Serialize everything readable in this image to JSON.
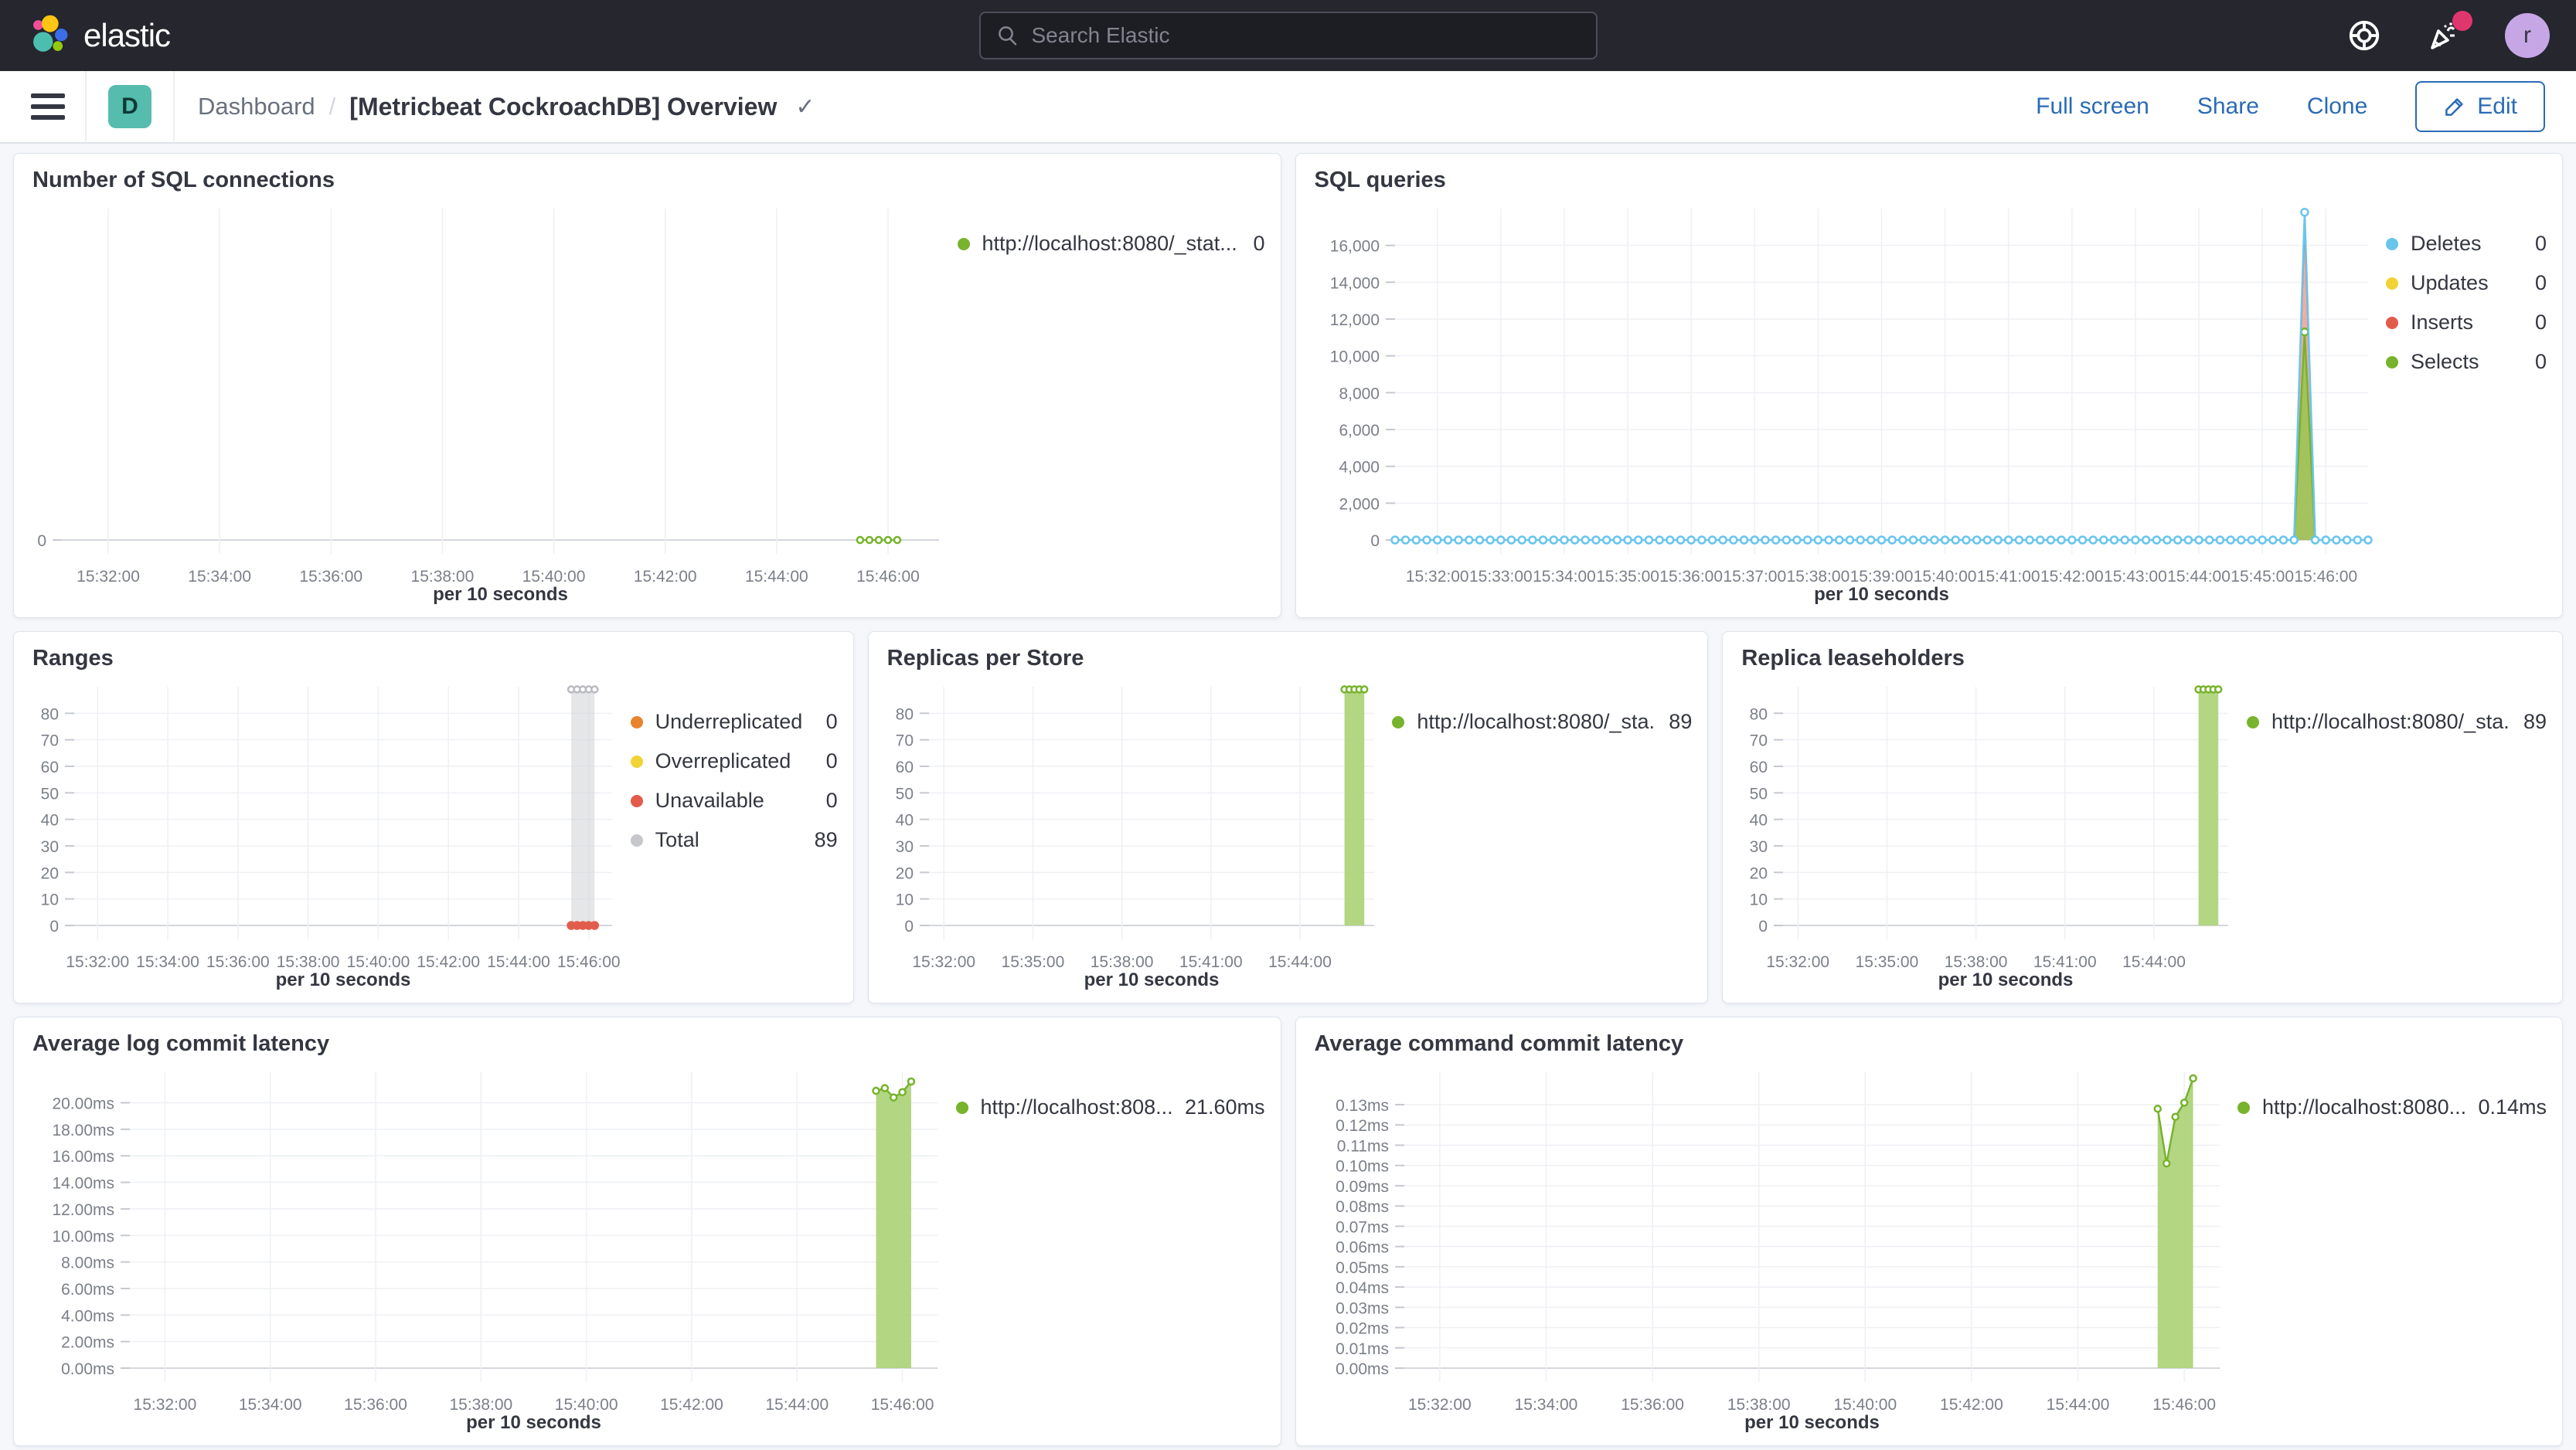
{
  "topbar": {
    "brand": "elastic",
    "search_placeholder": "Search Elastic",
    "avatar_initial": "r",
    "icons": {
      "search": "magnifier",
      "help": "life-ring",
      "news": "party-horn-with-alert",
      "menu": "hamburger",
      "edit": "pencil",
      "title_caret": "check-chevron"
    }
  },
  "navbar": {
    "badge_letter": "D",
    "breadcrumb_root": "Dashboard",
    "breadcrumb_sep": "/",
    "title": "[Metricbeat CockroachDB] Overview",
    "caret": "✓",
    "actions": {
      "full_screen": "Full screen",
      "share": "Share",
      "clone": "Clone",
      "edit": "Edit"
    }
  },
  "colors": {
    "green": "#77B32C",
    "blue": "#69C5EC",
    "yellow": "#F1D335",
    "red": "#E25C4C",
    "orange": "#E8842B",
    "gray": "#C5C7CB",
    "link_blue": "#2A6BB5",
    "accent_pink": "#E0366E",
    "badge_teal": "#55BCAE"
  },
  "panels": [
    {
      "title": "Number of SQL connections",
      "legend": [
        {
          "label": "http://localhost:8080/_stat...",
          "value": "0",
          "color": "#77B32C"
        }
      ]
    },
    {
      "title": "SQL queries",
      "legend": [
        {
          "label": "Deletes",
          "value": "0",
          "color": "#69C5EC"
        },
        {
          "label": "Updates",
          "value": "0",
          "color": "#F1D335"
        },
        {
          "label": "Inserts",
          "value": "0",
          "color": "#E25C4C"
        },
        {
          "label": "Selects",
          "value": "0",
          "color": "#77B32C"
        }
      ]
    },
    {
      "title": "Ranges",
      "legend": [
        {
          "label": "Underreplicated",
          "value": "0",
          "color": "#E8842B"
        },
        {
          "label": "Overreplicated",
          "value": "0",
          "color": "#F1D335"
        },
        {
          "label": "Unavailable",
          "value": "0",
          "color": "#E25C4C"
        },
        {
          "label": "Total",
          "value": "89",
          "color": "#C5C7CB"
        }
      ]
    },
    {
      "title": "Replicas per Store",
      "legend": [
        {
          "label": "http://localhost:8080/_sta...",
          "value": "89",
          "color": "#77B32C"
        }
      ]
    },
    {
      "title": "Replica leaseholders",
      "legend": [
        {
          "label": "http://localhost:8080/_sta...",
          "value": "89",
          "color": "#77B32C"
        }
      ]
    },
    {
      "title": "Average log commit latency",
      "legend": [
        {
          "label": "http://localhost:808...",
          "value": "21.60ms",
          "color": "#77B32C"
        }
      ]
    },
    {
      "title": "Average command commit latency",
      "legend": [
        {
          "label": "http://localhost:8080...",
          "value": "0.14ms",
          "color": "#77B32C"
        }
      ]
    }
  ],
  "chart_data": [
    {
      "type": "line",
      "title": "Number of SQL connections",
      "x_title": "per 10 seconds",
      "x_domain": [
        "15:31:10",
        "15:46:55"
      ],
      "y_max": 1,
      "ml": 62,
      "y_ticks": [
        {
          "v": 0,
          "label": "0"
        }
      ],
      "x_ticks": [
        {
          "t": "15:32:00",
          "label": "15:32:00"
        },
        {
          "t": "15:34:00",
          "label": "15:34:00"
        },
        {
          "t": "15:36:00",
          "label": "15:36:00"
        },
        {
          "t": "15:38:00",
          "label": "15:38:00"
        },
        {
          "t": "15:40:00",
          "label": "15:40:00"
        },
        {
          "t": "15:42:00",
          "label": "15:42:00"
        },
        {
          "t": "15:44:00",
          "label": "15:44:00"
        },
        {
          "t": "15:46:00",
          "label": "15:46:00"
        }
      ],
      "series": [
        {
          "name": "http://localhost:8080/_stat...",
          "color": "#77B32C",
          "line": true,
          "lw": 2,
          "markers": "open",
          "r": 4,
          "run": {
            "from": "15:45:30",
            "to": "15:46:10",
            "step": 10,
            "value": 0
          }
        }
      ]
    },
    {
      "type": "line",
      "title": "SQL queries",
      "x_title": "per 10 seconds",
      "x_domain": [
        "15:31:20",
        "15:46:40"
      ],
      "y_max": 18000,
      "ml": 128,
      "y_ticks": [
        {
          "v": 0,
          "label": "0"
        },
        {
          "v": 2000,
          "label": "2,000"
        },
        {
          "v": 4000,
          "label": "4,000"
        },
        {
          "v": 6000,
          "label": "6,000"
        },
        {
          "v": 8000,
          "label": "8,000"
        },
        {
          "v": 10000,
          "label": "10,000"
        },
        {
          "v": 12000,
          "label": "12,000"
        },
        {
          "v": 14000,
          "label": "14,000"
        },
        {
          "v": 16000,
          "label": "16,000"
        }
      ],
      "x_ticks": [
        {
          "t": "15:32:00",
          "label": "15:32:00"
        },
        {
          "t": "15:33:00",
          "label": "15:33:00"
        },
        {
          "t": "15:34:00",
          "label": "15:34:00"
        },
        {
          "t": "15:35:00",
          "label": "15:35:00"
        },
        {
          "t": "15:36:00",
          "label": "15:36:00"
        },
        {
          "t": "15:37:00",
          "label": "15:37:00"
        },
        {
          "t": "15:38:00",
          "label": "15:38:00"
        },
        {
          "t": "15:39:00",
          "label": "15:39:00"
        },
        {
          "t": "15:40:00",
          "label": "15:40:00"
        },
        {
          "t": "15:41:00",
          "label": "15:41:00"
        },
        {
          "t": "15:42:00",
          "label": "15:42:00"
        },
        {
          "t": "15:43:00",
          "label": "15:43:00"
        },
        {
          "t": "15:44:00",
          "label": "15:44:00"
        },
        {
          "t": "15:45:00",
          "label": "15:45:00"
        },
        {
          "t": "15:46:00",
          "label": "15:46:00"
        }
      ],
      "series": [
        {
          "name": "Inserts",
          "color": "#E25C4C",
          "fill": "rgba(226,92,76,0.5)",
          "line": true,
          "lw": 2,
          "markers": "none",
          "points": [
            [
              "15:45:30",
              0
            ],
            [
              "15:45:40",
              17200
            ],
            [
              "15:45:50",
              0
            ]
          ]
        },
        {
          "name": "Selects",
          "color": "#77B32C",
          "fill": "rgba(151,197,80,0.85)",
          "line": true,
          "lw": 2.5,
          "markers": "none",
          "points": [
            [
              "15:45:30",
              0
            ],
            [
              "15:45:40",
              11300
            ],
            [
              "15:45:50",
              0
            ]
          ]
        },
        {
          "name": "Selects-peak-marker",
          "color": "#77B32C",
          "markers": "open",
          "r": 4.5,
          "points": [
            [
              "15:45:40",
              11300
            ]
          ]
        },
        {
          "name": "Deletes",
          "color": "#69C5EC",
          "line": true,
          "lw": 2.5,
          "markers": "open",
          "r": 4.5,
          "run": {
            "from": "15:31:20",
            "to": "15:46:40",
            "step": 10,
            "value": 0
          },
          "points": [
            [
              "15:45:30",
              0
            ],
            [
              "15:45:40",
              17800
            ],
            [
              "15:45:50",
              0
            ]
          ]
        },
        {
          "name": "Updates",
          "color": "#F1D335",
          "points": []
        }
      ]
    },
    {
      "type": "bar",
      "title": "Ranges",
      "x_title": "per 10 seconds",
      "x_domain": [
        "15:31:20",
        "15:46:40"
      ],
      "y_max": 90,
      "ml": 78,
      "y_ticks": [
        {
          "v": 0,
          "label": "0"
        },
        {
          "v": 10,
          "label": "10"
        },
        {
          "v": 20,
          "label": "20"
        },
        {
          "v": 30,
          "label": "30"
        },
        {
          "v": 40,
          "label": "40"
        },
        {
          "v": 50,
          "label": "50"
        },
        {
          "v": 60,
          "label": "60"
        },
        {
          "v": 70,
          "label": "70"
        },
        {
          "v": 80,
          "label": "80"
        }
      ],
      "x_ticks": [
        {
          "t": "15:32:00",
          "label": "15:32:00"
        },
        {
          "t": "15:34:00",
          "label": "15:34:00"
        },
        {
          "t": "15:36:00",
          "label": "15:36:00"
        },
        {
          "t": "15:38:00",
          "label": "15:38:00"
        },
        {
          "t": "15:40:00",
          "label": "15:40:00"
        },
        {
          "t": "15:42:00",
          "label": "15:42:00"
        },
        {
          "t": "15:44:00",
          "label": "15:44:00"
        },
        {
          "t": "15:46:00",
          "label": "15:46:00"
        }
      ],
      "series": [
        {
          "name": "Total",
          "color": "#b9bbc0",
          "fill": "rgba(211,213,217,0.6)",
          "markers": "open",
          "r": 4,
          "points": [
            [
              "15:45:30",
              89
            ],
            [
              "15:45:40",
              89
            ],
            [
              "15:45:50",
              89
            ],
            [
              "15:46:00",
              89
            ],
            [
              "15:46:10",
              89
            ]
          ]
        },
        {
          "name": "Unavailable",
          "color": "#E25C4C",
          "line": true,
          "lw": 2.5,
          "markers": "solid",
          "r": 4.5,
          "run": {
            "from": "15:45:30",
            "to": "15:46:10",
            "step": 10,
            "value": 0
          }
        }
      ]
    },
    {
      "type": "bar",
      "title": "Replicas per Store",
      "x_title": "per 10 seconds",
      "x_domain": [
        "15:31:30",
        "15:46:30"
      ],
      "y_max": 90,
      "ml": 78,
      "y_ticks": [
        {
          "v": 0,
          "label": "0"
        },
        {
          "v": 10,
          "label": "10"
        },
        {
          "v": 20,
          "label": "20"
        },
        {
          "v": 30,
          "label": "30"
        },
        {
          "v": 40,
          "label": "40"
        },
        {
          "v": 50,
          "label": "50"
        },
        {
          "v": 60,
          "label": "60"
        },
        {
          "v": 70,
          "label": "70"
        },
        {
          "v": 80,
          "label": "80"
        }
      ],
      "x_ticks": [
        {
          "t": "15:32:00",
          "label": "15:32:00"
        },
        {
          "t": "15:35:00",
          "label": "15:35:00"
        },
        {
          "t": "15:38:00",
          "label": "15:38:00"
        },
        {
          "t": "15:41:00",
          "label": "15:41:00"
        },
        {
          "t": "15:44:00",
          "label": "15:44:00"
        }
      ],
      "series": [
        {
          "name": "http://localhost:8080/_sta...",
          "color": "#77B32C",
          "fill": "rgba(171,210,118,0.9)",
          "line": true,
          "lw": 2,
          "markers": "open",
          "r": 4,
          "points": [
            [
              "15:45:30",
              89
            ],
            [
              "15:45:40",
              89
            ],
            [
              "15:45:50",
              89
            ],
            [
              "15:46:00",
              89
            ],
            [
              "15:46:10",
              89
            ]
          ]
        }
      ]
    },
    {
      "type": "bar",
      "title": "Replica leaseholders",
      "x_title": "per 10 seconds",
      "x_domain": [
        "15:31:30",
        "15:46:30"
      ],
      "y_max": 90,
      "ml": 78,
      "y_ticks": [
        {
          "v": 0,
          "label": "0"
        },
        {
          "v": 10,
          "label": "10"
        },
        {
          "v": 20,
          "label": "20"
        },
        {
          "v": 30,
          "label": "30"
        },
        {
          "v": 40,
          "label": "40"
        },
        {
          "v": 50,
          "label": "50"
        },
        {
          "v": 60,
          "label": "60"
        },
        {
          "v": 70,
          "label": "70"
        },
        {
          "v": 80,
          "label": "80"
        }
      ],
      "x_ticks": [
        {
          "t": "15:32:00",
          "label": "15:32:00"
        },
        {
          "t": "15:35:00",
          "label": "15:35:00"
        },
        {
          "t": "15:38:00",
          "label": "15:38:00"
        },
        {
          "t": "15:41:00",
          "label": "15:41:00"
        },
        {
          "t": "15:44:00",
          "label": "15:44:00"
        }
      ],
      "series": [
        {
          "name": "http://localhost:8080/_sta...",
          "color": "#77B32C",
          "fill": "rgba(171,210,118,0.9)",
          "line": true,
          "lw": 2,
          "markers": "open",
          "r": 4,
          "points": [
            [
              "15:45:30",
              89
            ],
            [
              "15:45:40",
              89
            ],
            [
              "15:45:50",
              89
            ],
            [
              "15:46:00",
              89
            ],
            [
              "15:46:10",
              89
            ]
          ]
        }
      ]
    },
    {
      "type": "area",
      "title": "Average log commit latency",
      "x_title": "per 10 seconds",
      "x_domain": [
        "15:31:20",
        "15:46:40"
      ],
      "y_max": 22.3,
      "ml": 150,
      "y_ticks": [
        {
          "v": 0,
          "label": "0.00ms"
        },
        {
          "v": 2,
          "label": "2.00ms"
        },
        {
          "v": 4,
          "label": "4.00ms"
        },
        {
          "v": 6,
          "label": "6.00ms"
        },
        {
          "v": 8,
          "label": "8.00ms"
        },
        {
          "v": 10,
          "label": "10.00ms"
        },
        {
          "v": 12,
          "label": "12.00ms"
        },
        {
          "v": 14,
          "label": "14.00ms"
        },
        {
          "v": 16,
          "label": "16.00ms"
        },
        {
          "v": 18,
          "label": "18.00ms"
        },
        {
          "v": 20,
          "label": "20.00ms"
        }
      ],
      "x_ticks": [
        {
          "t": "15:32:00",
          "label": "15:32:00"
        },
        {
          "t": "15:34:00",
          "label": "15:34:00"
        },
        {
          "t": "15:36:00",
          "label": "15:36:00"
        },
        {
          "t": "15:38:00",
          "label": "15:38:00"
        },
        {
          "t": "15:40:00",
          "label": "15:40:00"
        },
        {
          "t": "15:42:00",
          "label": "15:42:00"
        },
        {
          "t": "15:44:00",
          "label": "15:44:00"
        },
        {
          "t": "15:46:00",
          "label": "15:46:00"
        }
      ],
      "series": [
        {
          "name": "http://localhost:808...",
          "color": "#77B32C",
          "fill": "rgba(171,210,118,0.9)",
          "line": true,
          "lw": 2.5,
          "markers": "open",
          "r": 4,
          "points": [
            [
              "15:45:30",
              20.9
            ],
            [
              "15:45:40",
              21.1
            ],
            [
              "15:45:50",
              20.4
            ],
            [
              "15:46:00",
              20.8
            ],
            [
              "15:46:10",
              21.6
            ]
          ]
        }
      ]
    },
    {
      "type": "area",
      "title": "Average command commit latency",
      "x_title": "per 10 seconds",
      "x_domain": [
        "15:31:20",
        "15:46:40"
      ],
      "y_max": 0.146,
      "ml": 140,
      "y_ticks": [
        {
          "v": 0,
          "label": "0.00ms"
        },
        {
          "v": 0.01,
          "label": "0.01ms"
        },
        {
          "v": 0.02,
          "label": "0.02ms"
        },
        {
          "v": 0.03,
          "label": "0.03ms"
        },
        {
          "v": 0.04,
          "label": "0.04ms"
        },
        {
          "v": 0.05,
          "label": "0.05ms"
        },
        {
          "v": 0.06,
          "label": "0.06ms"
        },
        {
          "v": 0.07,
          "label": "0.07ms"
        },
        {
          "v": 0.08,
          "label": "0.08ms"
        },
        {
          "v": 0.09,
          "label": "0.09ms"
        },
        {
          "v": 0.1,
          "label": "0.10ms"
        },
        {
          "v": 0.11,
          "label": "0.11ms"
        },
        {
          "v": 0.12,
          "label": "0.12ms"
        },
        {
          "v": 0.13,
          "label": "0.13ms"
        }
      ],
      "x_ticks": [
        {
          "t": "15:32:00",
          "label": "15:32:00"
        },
        {
          "t": "15:34:00",
          "label": "15:34:00"
        },
        {
          "t": "15:36:00",
          "label": "15:36:00"
        },
        {
          "t": "15:38:00",
          "label": "15:38:00"
        },
        {
          "t": "15:40:00",
          "label": "15:40:00"
        },
        {
          "t": "15:42:00",
          "label": "15:42:00"
        },
        {
          "t": "15:44:00",
          "label": "15:44:00"
        },
        {
          "t": "15:46:00",
          "label": "15:46:00"
        }
      ],
      "series": [
        {
          "name": "http://localhost:8080...",
          "color": "#77B32C",
          "fill": "rgba(171,210,118,0.9)",
          "line": true,
          "lw": 2.5,
          "markers": "open",
          "r": 4,
          "points": [
            [
              "15:45:30",
              0.128
            ],
            [
              "15:45:40",
              0.101
            ],
            [
              "15:45:50",
              0.124
            ],
            [
              "15:46:00",
              0.131
            ],
            [
              "15:46:10",
              0.143
            ]
          ]
        }
      ]
    }
  ]
}
